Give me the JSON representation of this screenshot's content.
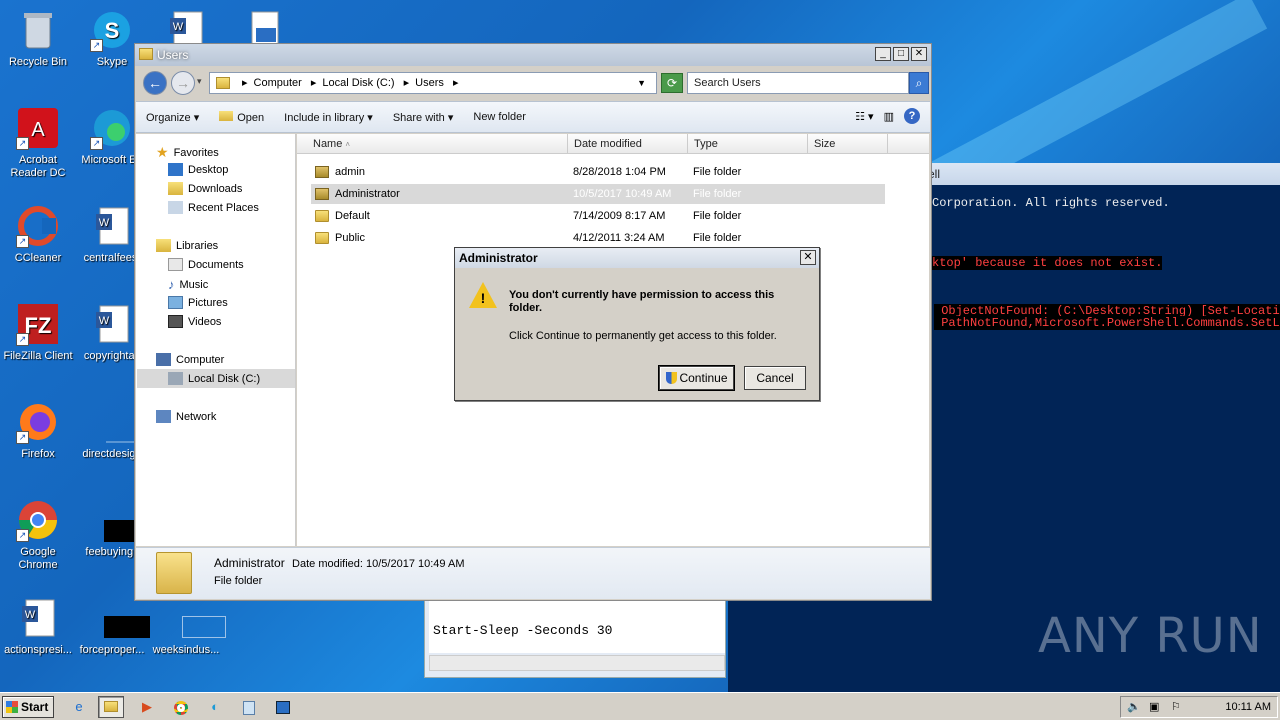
{
  "desktop": {
    "icons": [
      {
        "label": "Recycle Bin"
      },
      {
        "label": "Skype"
      },
      {
        "label": "Acrobat Reader DC"
      },
      {
        "label": "Microsoft Ed"
      },
      {
        "label": "CCleaner"
      },
      {
        "label": "centralfees."
      },
      {
        "label": "FileZilla Client"
      },
      {
        "label": "copyrightac"
      },
      {
        "label": "Firefox"
      },
      {
        "label": "directdesign"
      },
      {
        "label": "Google Chrome"
      },
      {
        "label": "feebuying.j"
      },
      {
        "label": "actionspresi..."
      },
      {
        "label": "forceproper..."
      },
      {
        "label": "weeksindus..."
      }
    ]
  },
  "powershell": {
    "title": "ell",
    "lines": [
      "Corporation. All rights reserved.",
      "ktop' because it does not exist.",
      " ObjectNotFound: (C:\\Desktop:String) [Set-Location",
      " PathNotFound,Microsoft.PowerShell.Commands.SetLoc"
    ]
  },
  "notepad": {
    "text": "Start-Sleep -Seconds 30"
  },
  "explorer": {
    "title": "Users",
    "breadcrumb": [
      "Computer",
      "Local Disk (C:)",
      "Users"
    ],
    "search_placeholder": "Search Users",
    "toolbar": {
      "organize": "Organize",
      "open": "Open",
      "include": "Include in library",
      "share": "Share with",
      "new_folder": "New folder"
    },
    "nav": {
      "favorites": "Favorites",
      "desktop": "Desktop",
      "downloads": "Downloads",
      "recent": "Recent Places",
      "libraries": "Libraries",
      "documents": "Documents",
      "music": "Music",
      "pictures": "Pictures",
      "videos": "Videos",
      "computer": "Computer",
      "local_disk": "Local Disk (C:)",
      "network": "Network"
    },
    "columns": {
      "name": "Name",
      "date": "Date modified",
      "type": "Type",
      "size": "Size"
    },
    "rows": [
      {
        "name": "admin",
        "date": "8/28/2018 1:04 PM",
        "type": "File folder"
      },
      {
        "name": "Administrator",
        "date": "10/5/2017 10:49 AM",
        "type": "File folder"
      },
      {
        "name": "Default",
        "date": "7/14/2009 8:17 AM",
        "type": "File folder"
      },
      {
        "name": "Public",
        "date": "4/12/2011 3:24 AM",
        "type": "File folder"
      }
    ],
    "details": {
      "name": "Administrator",
      "date_label": "Date modified: 10/5/2017 10:49 AM",
      "type": "File folder"
    }
  },
  "dialog": {
    "title": "Administrator",
    "message": "You don't currently have permission to access this folder.",
    "sub": "Click Continue to permanently get access to this folder.",
    "continue": "Continue",
    "cancel": "Cancel"
  },
  "taskbar": {
    "start": "Start",
    "clock": "10:11 AM"
  },
  "watermark": "ANY RUN"
}
